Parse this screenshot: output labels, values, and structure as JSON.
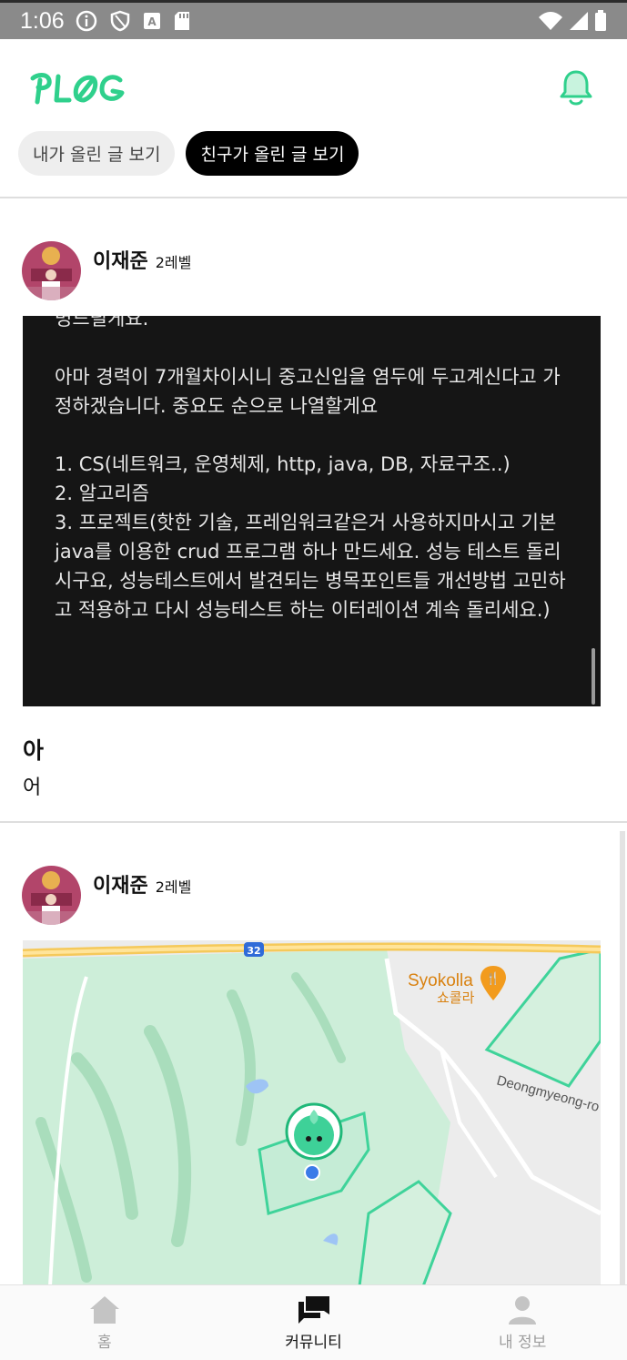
{
  "status_bar": {
    "time": "1:06",
    "icons": [
      "info-icon",
      "shield-icon",
      "keyboard-icon",
      "sd-card-icon",
      "wifi-icon",
      "signal-icon",
      "battery-icon"
    ]
  },
  "app": {
    "logo_text": "PLOG",
    "brand_color": "#2fd08c",
    "header_icon": "bell-icon"
  },
  "tabs": [
    {
      "label": "내가 올린 글 보기",
      "active": false
    },
    {
      "label": "친구가 올린 글 보기",
      "active": true
    }
  ],
  "posts": [
    {
      "author": "이재준",
      "level": "2레벨",
      "image_text": {
        "lines_top": "명드릴게요.",
        "paragraph1": "아마 경력이 7개월차이시니 중고신입을 염두에 두고계신다고 가정하겠습니다. 중요도 순으로 나열할게요",
        "items": [
          "1. CS(네트워크, 운영체제, http, java, DB, 자료구조..)",
          "2. 알고리즘",
          "3. 프로젝트(핫한 기술, 프레임워크같은거 사용하지마시고 기본 java를 이용한 crud 프로그램 하나 만드세요. 성능 테스트 돌리시구요, 성능테스트에서 발견되는 병목포인트들 개선방법 고민하고 적용하고 다시 성능테스트 하는 이터레이션 계속 돌리세요.)"
        ]
      },
      "title": "아",
      "body": "어"
    },
    {
      "author": "이재준",
      "level": "2레벨",
      "map": {
        "road_number": "32",
        "place_name": "Syokolla",
        "place_name_local": "쇼콜라",
        "street_label": "Deongmyeong-ro"
      }
    }
  ],
  "bottom_nav": [
    {
      "label": "홈",
      "icon": "home-icon",
      "active": false
    },
    {
      "label": "커뮤니티",
      "icon": "community-icon",
      "active": true
    },
    {
      "label": "내 정보",
      "icon": "profile-icon",
      "active": false
    }
  ]
}
